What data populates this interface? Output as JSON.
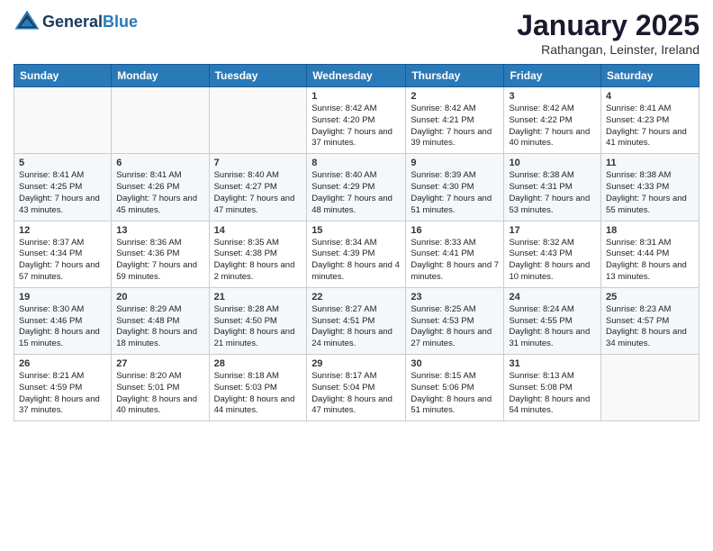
{
  "header": {
    "logo_line1": "General",
    "logo_line2": "Blue",
    "month_title": "January 2025",
    "location": "Rathangan, Leinster, Ireland"
  },
  "days_of_week": [
    "Sunday",
    "Monday",
    "Tuesday",
    "Wednesday",
    "Thursday",
    "Friday",
    "Saturday"
  ],
  "weeks": [
    [
      {
        "day": "",
        "info": ""
      },
      {
        "day": "",
        "info": ""
      },
      {
        "day": "",
        "info": ""
      },
      {
        "day": "1",
        "info": "Sunrise: 8:42 AM\nSunset: 4:20 PM\nDaylight: 7 hours and 37 minutes."
      },
      {
        "day": "2",
        "info": "Sunrise: 8:42 AM\nSunset: 4:21 PM\nDaylight: 7 hours and 39 minutes."
      },
      {
        "day": "3",
        "info": "Sunrise: 8:42 AM\nSunset: 4:22 PM\nDaylight: 7 hours and 40 minutes."
      },
      {
        "day": "4",
        "info": "Sunrise: 8:41 AM\nSunset: 4:23 PM\nDaylight: 7 hours and 41 minutes."
      }
    ],
    [
      {
        "day": "5",
        "info": "Sunrise: 8:41 AM\nSunset: 4:25 PM\nDaylight: 7 hours and 43 minutes."
      },
      {
        "day": "6",
        "info": "Sunrise: 8:41 AM\nSunset: 4:26 PM\nDaylight: 7 hours and 45 minutes."
      },
      {
        "day": "7",
        "info": "Sunrise: 8:40 AM\nSunset: 4:27 PM\nDaylight: 7 hours and 47 minutes."
      },
      {
        "day": "8",
        "info": "Sunrise: 8:40 AM\nSunset: 4:29 PM\nDaylight: 7 hours and 48 minutes."
      },
      {
        "day": "9",
        "info": "Sunrise: 8:39 AM\nSunset: 4:30 PM\nDaylight: 7 hours and 51 minutes."
      },
      {
        "day": "10",
        "info": "Sunrise: 8:38 AM\nSunset: 4:31 PM\nDaylight: 7 hours and 53 minutes."
      },
      {
        "day": "11",
        "info": "Sunrise: 8:38 AM\nSunset: 4:33 PM\nDaylight: 7 hours and 55 minutes."
      }
    ],
    [
      {
        "day": "12",
        "info": "Sunrise: 8:37 AM\nSunset: 4:34 PM\nDaylight: 7 hours and 57 minutes."
      },
      {
        "day": "13",
        "info": "Sunrise: 8:36 AM\nSunset: 4:36 PM\nDaylight: 7 hours and 59 minutes."
      },
      {
        "day": "14",
        "info": "Sunrise: 8:35 AM\nSunset: 4:38 PM\nDaylight: 8 hours and 2 minutes."
      },
      {
        "day": "15",
        "info": "Sunrise: 8:34 AM\nSunset: 4:39 PM\nDaylight: 8 hours and 4 minutes."
      },
      {
        "day": "16",
        "info": "Sunrise: 8:33 AM\nSunset: 4:41 PM\nDaylight: 8 hours and 7 minutes."
      },
      {
        "day": "17",
        "info": "Sunrise: 8:32 AM\nSunset: 4:43 PM\nDaylight: 8 hours and 10 minutes."
      },
      {
        "day": "18",
        "info": "Sunrise: 8:31 AM\nSunset: 4:44 PM\nDaylight: 8 hours and 13 minutes."
      }
    ],
    [
      {
        "day": "19",
        "info": "Sunrise: 8:30 AM\nSunset: 4:46 PM\nDaylight: 8 hours and 15 minutes."
      },
      {
        "day": "20",
        "info": "Sunrise: 8:29 AM\nSunset: 4:48 PM\nDaylight: 8 hours and 18 minutes."
      },
      {
        "day": "21",
        "info": "Sunrise: 8:28 AM\nSunset: 4:50 PM\nDaylight: 8 hours and 21 minutes."
      },
      {
        "day": "22",
        "info": "Sunrise: 8:27 AM\nSunset: 4:51 PM\nDaylight: 8 hours and 24 minutes."
      },
      {
        "day": "23",
        "info": "Sunrise: 8:25 AM\nSunset: 4:53 PM\nDaylight: 8 hours and 27 minutes."
      },
      {
        "day": "24",
        "info": "Sunrise: 8:24 AM\nSunset: 4:55 PM\nDaylight: 8 hours and 31 minutes."
      },
      {
        "day": "25",
        "info": "Sunrise: 8:23 AM\nSunset: 4:57 PM\nDaylight: 8 hours and 34 minutes."
      }
    ],
    [
      {
        "day": "26",
        "info": "Sunrise: 8:21 AM\nSunset: 4:59 PM\nDaylight: 8 hours and 37 minutes."
      },
      {
        "day": "27",
        "info": "Sunrise: 8:20 AM\nSunset: 5:01 PM\nDaylight: 8 hours and 40 minutes."
      },
      {
        "day": "28",
        "info": "Sunrise: 8:18 AM\nSunset: 5:03 PM\nDaylight: 8 hours and 44 minutes."
      },
      {
        "day": "29",
        "info": "Sunrise: 8:17 AM\nSunset: 5:04 PM\nDaylight: 8 hours and 47 minutes."
      },
      {
        "day": "30",
        "info": "Sunrise: 8:15 AM\nSunset: 5:06 PM\nDaylight: 8 hours and 51 minutes."
      },
      {
        "day": "31",
        "info": "Sunrise: 8:13 AM\nSunset: 5:08 PM\nDaylight: 8 hours and 54 minutes."
      },
      {
        "day": "",
        "info": ""
      }
    ]
  ]
}
